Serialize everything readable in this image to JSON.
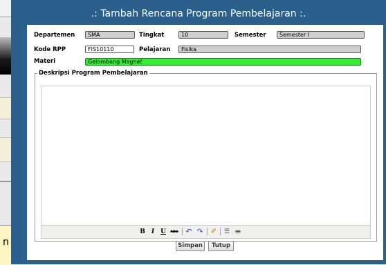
{
  "background": {
    "partial_char": "n"
  },
  "dialog": {
    "title": ".: Tambah Rencana Program Pembelajaran :."
  },
  "form": {
    "departemen_label": "Departemen",
    "departemen_value": "SMA",
    "tingkat_label": "Tingkat",
    "tingkat_value": "10",
    "semester_label": "Semester",
    "semester_value": "Semester I",
    "kode_rpp_label": "Kode RPP",
    "kode_rpp_value": "FIS10110",
    "pelajaran_label": "Pelajaran",
    "pelajaran_value": "Fisika",
    "materi_label": "Materi",
    "materi_value": "Gelombang Magnet",
    "deskripsi_legend": "Deskripsi Program Pembelajaran",
    "deskripsi_value": ""
  },
  "toolbar": {
    "bold": "B",
    "italic": "I",
    "underline": "U",
    "strike": "ABC",
    "undo": "↶",
    "redo": "↷",
    "cleanup": "✐",
    "bullets": "☰",
    "numbered": "≡",
    "icons": [
      "bold-icon",
      "italic-icon",
      "underline-icon",
      "strikethrough-icon",
      "undo-icon",
      "redo-icon",
      "cleanup-icon",
      "bullet-list-icon",
      "numbered-list-icon"
    ]
  },
  "buttons": {
    "simpan": "Simpan",
    "tutup": "Tutup"
  },
  "colors": {
    "dialog_bg": "#2b5f8c",
    "materi_bg": "#33ee33",
    "readonly_bg": "#cfcfcf"
  }
}
